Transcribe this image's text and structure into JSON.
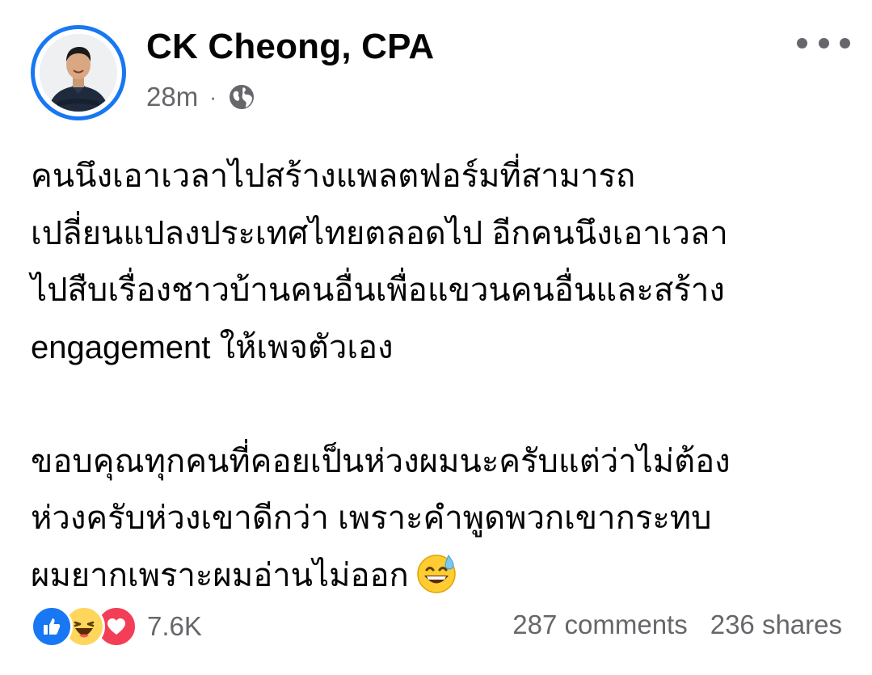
{
  "post": {
    "author": "CK Cheong, CPA",
    "time": "28m",
    "separator": "·",
    "audience_icon": "globe-icon",
    "more_icon": "more-options-icon",
    "text_lines": [
      "คนนึงเอาเวลาไปสร้างแพลตฟอร์มที่สามารถ",
      "เปลี่ยนแปลงประเทศไทยตลอดไป อีกคนนึงเอาเวลา",
      "ไปสืบเรื่องชาวบ้านคนอื่นเพื่อแขวนคนอื่นและสร้าง",
      "engagement ให้เพจตัวเอง",
      "ขอบคุณทุกคนที่คอยเป็นห่วงผมนะครับแต่ว่าไม่ต้อง",
      "ห่วงครับห่วงเขาดีกว่า เพราะคำพูดพวกเขากระทบ",
      "ผมยากเพราะผมอ่านไม่ออก"
    ],
    "inline_emoji": "grinning-sweat-emoji"
  },
  "footer": {
    "reaction_icons": [
      "like-icon",
      "haha-icon",
      "love-icon"
    ],
    "reaction_count": "7.6K",
    "comments": "287 comments",
    "shares": "236 shares"
  },
  "colors": {
    "accent": "#1877f2",
    "text": "#050505",
    "secondary_text": "#65676b",
    "love": "#f33e58",
    "haha": "#ffd65c"
  }
}
